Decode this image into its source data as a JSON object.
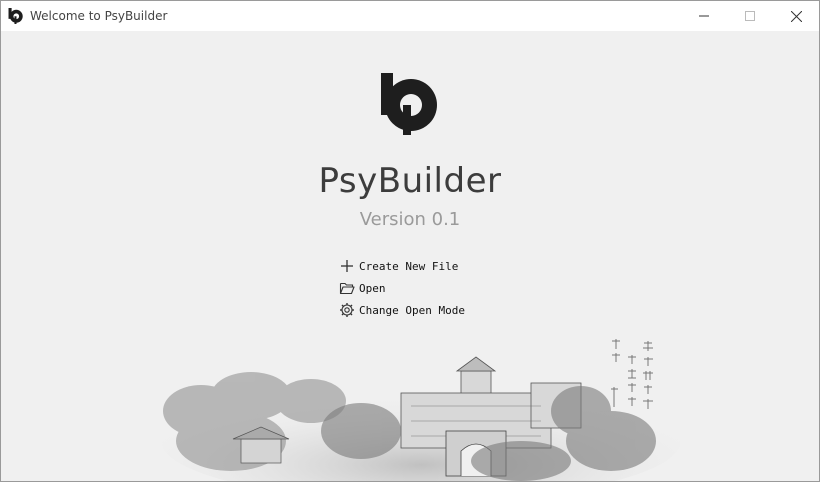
{
  "window": {
    "title": "Welcome to PsyBuilder",
    "icons": {
      "app": "psybuilder-logo-icon",
      "minimize": "minimize-icon",
      "maximize": "maximize-icon",
      "close": "close-icon"
    }
  },
  "main": {
    "app_name": "PsyBuilder",
    "version": "Version 0.1",
    "actions": [
      {
        "label": "Create New File",
        "icon": "plus-icon"
      },
      {
        "label": "Open",
        "icon": "folder-open-icon"
      },
      {
        "label": "Change Open Mode",
        "icon": "gear-icon"
      }
    ]
  },
  "colors": {
    "background": "#f0f0f0",
    "titlebar": "#ffffff",
    "logo": "#1e1e1e",
    "app_name_text": "#3c3c3c",
    "version_text": "#9a9a9a"
  }
}
